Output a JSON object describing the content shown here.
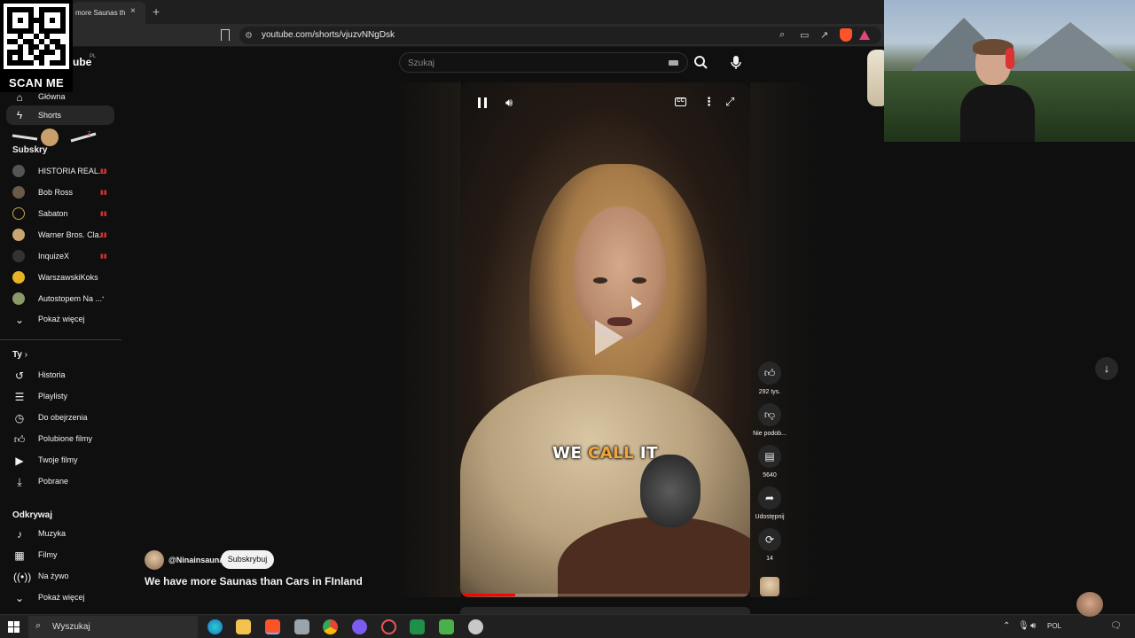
{
  "browser": {
    "tab_title": "more Saunas th",
    "tab_close": "×",
    "new_tab": "+",
    "url": "youtube.com/shorts/vjuzvNNgDsk"
  },
  "qr": {
    "label": "SCAN ME"
  },
  "header": {
    "logo_text": "ube",
    "logo_country": "PL",
    "search_placeholder": "Szukaj"
  },
  "sidebar": {
    "main": [
      {
        "label": "Główna",
        "icon": "home-icon"
      },
      {
        "label": "Shorts",
        "icon": "shorts-icon"
      }
    ],
    "subs_title": "Subskry",
    "subscriptions": [
      {
        "name": "HISTORIA REAL...",
        "live": true
      },
      {
        "name": "Bob Ross",
        "live": true
      },
      {
        "name": "Sabaton",
        "live": true
      },
      {
        "name": "Warner Bros. Cla...",
        "live": true
      },
      {
        "name": "InquizeX",
        "live": true
      },
      {
        "name": "WarszawskiKoks",
        "live": false
      },
      {
        "name": "Autostopem Na ...",
        "live": false
      }
    ],
    "show_more": "Pokaż więcej",
    "you_title": "Ty",
    "you_items": [
      {
        "label": "Historia",
        "icon": "history-icon"
      },
      {
        "label": "Playlisty",
        "icon": "playlist-icon"
      },
      {
        "label": "Do obejrzenia",
        "icon": "clock-icon"
      },
      {
        "label": "Polubione filmy",
        "icon": "like-icon"
      },
      {
        "label": "Twoje filmy",
        "icon": "video-icon"
      },
      {
        "label": "Pobrane",
        "icon": "download-icon"
      }
    ],
    "explore_title": "Odkrywaj",
    "explore_items": [
      {
        "label": "Muzyka",
        "icon": "music-icon"
      },
      {
        "label": "Filmy",
        "icon": "film-icon"
      },
      {
        "label": "Na żywo",
        "icon": "live-icon"
      }
    ],
    "show_more_2": "Pokaż więcej"
  },
  "video": {
    "caption_pre": "WE ",
    "caption_hl": "CALL",
    "caption_post": " IT",
    "progress": 0.19,
    "channel": "@Ninainsauna",
    "subscribe": "Subskrybuj",
    "title": "We have more Saunas than Cars in FInland"
  },
  "actions": {
    "likes": "292 tys.",
    "dislike": "Nie podob...",
    "comments": "5640",
    "share": "Udostępnij",
    "remix": "14"
  },
  "taskbar": {
    "search_text": "Wyszukaj",
    "lang": "POL"
  }
}
